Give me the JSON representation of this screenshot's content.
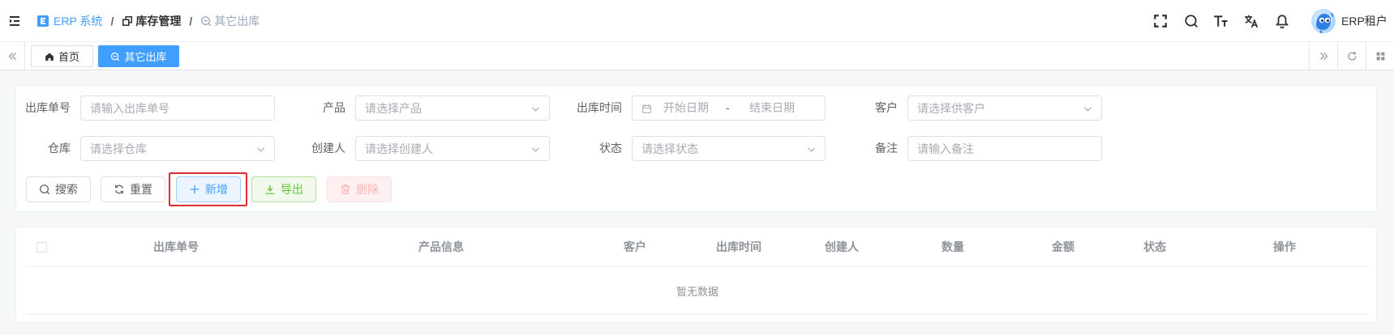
{
  "header": {
    "breadcrumb": [
      {
        "label": "ERP 系统",
        "icon": "erp-logo-icon"
      },
      {
        "label": "库存管理",
        "icon": "inventory-icon"
      },
      {
        "label": "其它出库",
        "icon": "outbound-icon"
      }
    ],
    "separator": "/",
    "toolbar_icons": [
      "fullscreen-icon",
      "search-icon",
      "font-size-icon",
      "translate-icon",
      "bell-icon"
    ],
    "user": {
      "name": "ERP租户"
    }
  },
  "tabs": {
    "items": [
      {
        "label": "首页",
        "icon": "home-icon",
        "active": false
      },
      {
        "label": "其它出库",
        "icon": "outbound-icon",
        "active": true
      }
    ]
  },
  "search_form": {
    "outbound_no": {
      "label": "出库单号",
      "placeholder": "请输入出库单号"
    },
    "product": {
      "label": "产品",
      "placeholder": "请选择产品"
    },
    "outbound_time": {
      "label": "出库时间",
      "start_placeholder": "开始日期",
      "separator": "-",
      "end_placeholder": "结束日期"
    },
    "customer": {
      "label": "客户",
      "placeholder": "请选择供客户"
    },
    "warehouse": {
      "label": "仓库",
      "placeholder": "请选择仓库"
    },
    "creator": {
      "label": "创建人",
      "placeholder": "请选择创建人"
    },
    "status": {
      "label": "状态",
      "placeholder": "请选择状态"
    },
    "remark": {
      "label": "备注",
      "placeholder": "请输入备注"
    }
  },
  "actions": {
    "search": "搜索",
    "reset": "重置",
    "add": "新增",
    "export": "导出",
    "delete": "删除"
  },
  "table": {
    "columns": [
      "出库单号",
      "产品信息",
      "客户",
      "出库时间",
      "创建人",
      "数量",
      "金额",
      "状态",
      "操作"
    ],
    "rows": [],
    "empty_text": "暂无数据"
  },
  "colors": {
    "primary": "#409eff",
    "success": "#67c23a",
    "danger": "#f56c6c",
    "highlight": "#e02d2d"
  }
}
